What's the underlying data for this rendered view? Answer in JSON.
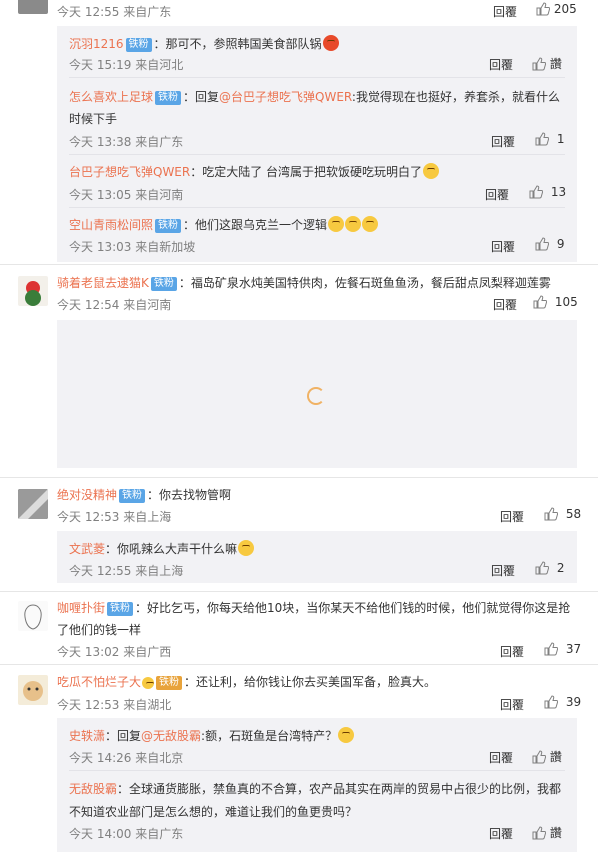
{
  "actions": {
    "reply": "回覆",
    "like_icon": "thumbs-up-icon",
    "like_text": "讚"
  },
  "colors": {
    "name": "#eb7350",
    "badge": "#5aa5e6",
    "reply_bg": "#f2f2f5"
  },
  "c0": {
    "meta": "今天 12:55 来自广东",
    "likes": "205"
  },
  "r1": {
    "name": "沉羽1216",
    "badge": "铁粉",
    "text": "：那可不，参照韩国美食部队锅",
    "meta": "今天 15:19 来自河北"
  },
  "r2": {
    "name": "怎么喜欢上足球",
    "badge": "铁粉",
    "text1": "：回复",
    "mention": "@台巴子想吃飞弹QWER",
    "text2": ":我觉得现在也挺好，养套杀，就看什么",
    "text3": "时候下手",
    "meta": "今天 13:38 来自广东",
    "likes": "1"
  },
  "r3": {
    "name": "台巴子想吃飞弹QWER",
    "text": "：吃定大陆了 台湾属于把软饭硬吃玩明白了",
    "meta": "今天 13:05 来自河南",
    "likes": "13"
  },
  "r4": {
    "name": "空山青雨松间照",
    "badge": "铁粉",
    "text": "：他们这跟乌克兰一个逻辑",
    "meta": "今天 13:03 来自新加坡",
    "likes": "9"
  },
  "c1": {
    "name": "骑着老鼠去逮猫K",
    "badge": "铁粉",
    "text": "：福岛矿泉水炖美国特供肉，佐餐石斑鱼鱼汤，餐后甜点凤梨释迦莲雾",
    "meta": "今天 12:54 来自河南",
    "likes": "105"
  },
  "c2": {
    "name": "绝对没精神",
    "badge": "铁粉",
    "text": "：你去找物管啊",
    "meta": "今天 12:53 来自上海",
    "likes": "58"
  },
  "r5": {
    "name": "文武菱",
    "text": "：你吼辣么大声干什么嘛",
    "meta": "今天 12:55 来自上海",
    "likes": "2"
  },
  "c3": {
    "name": "咖喱扑街",
    "badge": "铁粉",
    "text1": "：好比乞丐，你每天给他10块，当你某天不给他们钱的时候，他们就觉得你这是抢",
    "text2": "了他们的钱一样",
    "meta": "今天 13:02 来自广西",
    "likes": "37"
  },
  "c4": {
    "name": "吃瓜不怕烂子大",
    "badge": "铁粉",
    "text": "：还让利，给你钱让你去买美国军备，脸真大。",
    "meta": "今天 12:53 来自湖北",
    "likes": "39"
  },
  "r6": {
    "name": "史轶潇",
    "text1": "：回复",
    "mention": "@无敌股霸",
    "text2": ":额，石斑鱼是台湾特产？",
    "meta": "今天 14:26 来自北京"
  },
  "r7": {
    "name": "无敌股霸",
    "text1": "：全球通货膨胀，禁鱼真的不合算，农产品其实在两岸的贸易中占很少的比例，我都",
    "text2": "不知道农业部门是怎么想的，难道让我们的鱼更贵吗？",
    "meta": "今天 14:00 来自广东"
  }
}
